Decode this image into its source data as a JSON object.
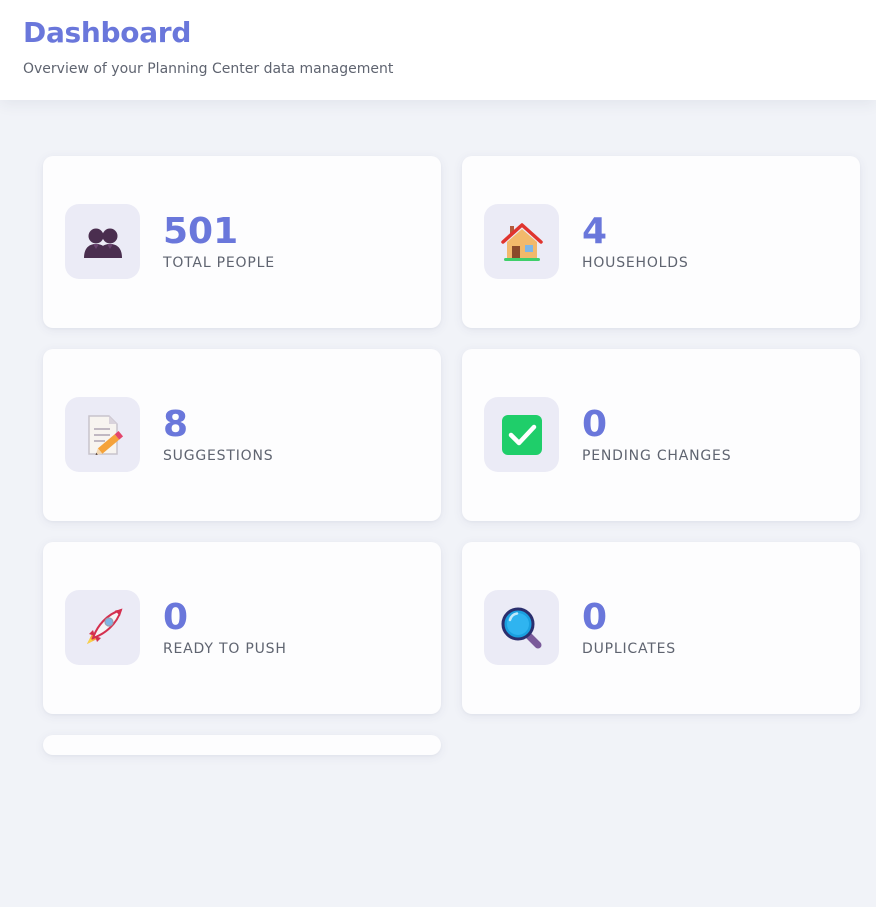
{
  "header": {
    "title": "Dashboard",
    "subtitle": "Overview of your Planning Center data management"
  },
  "colors": {
    "accent": "#6a77db",
    "icon_bg": "#ebebf6",
    "text_muted": "#5f6470"
  },
  "stats": [
    {
      "value": "501",
      "label": "TOTAL PEOPLE",
      "icon": "people-icon"
    },
    {
      "value": "4",
      "label": "HOUSEHOLDS",
      "icon": "house-icon"
    },
    {
      "value": "8",
      "label": "SUGGESTIONS",
      "icon": "memo-pencil-icon"
    },
    {
      "value": "0",
      "label": "PENDING CHANGES",
      "icon": "check-mark-icon"
    },
    {
      "value": "0",
      "label": "READY TO PUSH",
      "icon": "rocket-icon"
    },
    {
      "value": "0",
      "label": "DUPLICATES",
      "icon": "magnifier-icon"
    }
  ]
}
